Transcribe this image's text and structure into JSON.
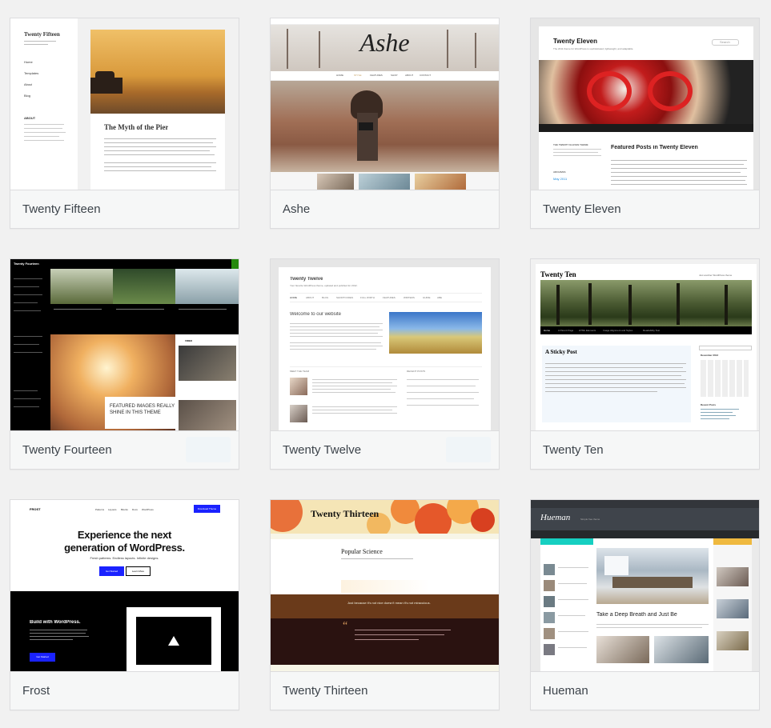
{
  "themes": [
    {
      "name": "Twenty Fifteen",
      "preview": {
        "site_title": "Twenty Fifteen",
        "post_title": "The Myth of the Pier",
        "menu": [
          "Home",
          "Templates",
          "About",
          "Blog"
        ],
        "widget": "ABOUT"
      }
    },
    {
      "name": "Ashe",
      "preview": {
        "site_title": "Ashe",
        "menu": [
          "HOME",
          "STYLE",
          "FEATURES",
          "SHOP",
          "ABOUT",
          "CONTACT"
        ]
      }
    },
    {
      "name": "Twenty Eleven",
      "preview": {
        "site_title": "Twenty Eleven",
        "tagline": "The 2011 theme for WordPress is sophisticated, lightweight, and adaptable.",
        "post_title": "Featured Posts in Twenty Eleven",
        "search": "Search",
        "widget": "THE TWENTY ELEVEN THEME",
        "archives_label": "ARCHIVES",
        "archive_item": "May 2011"
      }
    },
    {
      "name": "Twenty Fourteen",
      "preview": {
        "site_title": "Twenty Fourteen",
        "featured": "FEATURED IMAGES REALLY SHINE IN THIS THEME",
        "video_label": "VIDEO"
      }
    },
    {
      "name": "Twenty Twelve",
      "preview": {
        "site_title": "Twenty Twelve",
        "tagline": "Your favorite WordPress theme, updated and polished for 2012.",
        "menu": [
          "HOME",
          "ABOUT",
          "BLOG",
          "SHORTCODES",
          "FULL WIDTH",
          "FEATURES",
          "WRITERS",
          "GUIDE",
          "ABE"
        ],
        "welcome": "Welcome to our website",
        "section_left": "MEET THE TEAM",
        "section_right": "RECENT POSTS"
      }
    },
    {
      "name": "Twenty Ten",
      "preview": {
        "site_title": "Twenty Ten",
        "tagline": "Just another WordPress theme",
        "post_title": "A Sticky Post",
        "calendar_title": "December 2013",
        "recent_posts": "Recent Posts",
        "nav": [
          "Home",
          "A Parent Page",
          "HTML Elements",
          "Image Alignment and Styles",
          "Readability Test"
        ]
      }
    },
    {
      "name": "Frost",
      "preview": {
        "logo": "FROST",
        "menu": [
          "Patterns",
          "Layouts",
          "Blocks",
          "Docs",
          "WordPress"
        ],
        "cta": "Download Theme",
        "headline_1": "Experience the next",
        "headline_2": "generation of WordPress.",
        "subhead": "Fresh patterns. Endless layouts. Infinite designs.",
        "btn_primary": "Get Started",
        "btn_secondary": "Learn More",
        "dark_title": "Build with WordPress.",
        "dark_btn": "Get Started"
      }
    },
    {
      "name": "Twenty Thirteen",
      "preview": {
        "site_title": "Twenty Thirteen",
        "post_title": "Popular Science",
        "quote": "Just because it's not nice doesn't mean it's not miraculous."
      }
    },
    {
      "name": "Hueman",
      "preview": {
        "site_title": "Hueman",
        "tagline": "Simple free theme",
        "post_title": "Take a Deep Breath and Just Be"
      }
    }
  ],
  "colors": {
    "card_border": "#dcdcde",
    "namebar_bg": "#f6f7f7",
    "name_text": "#3c434a",
    "page_bg": "#f1f1f1",
    "frost_blue": "#1a22ff",
    "fourteen_green": "#24890d",
    "hueman_teal": "#16cfc1"
  }
}
